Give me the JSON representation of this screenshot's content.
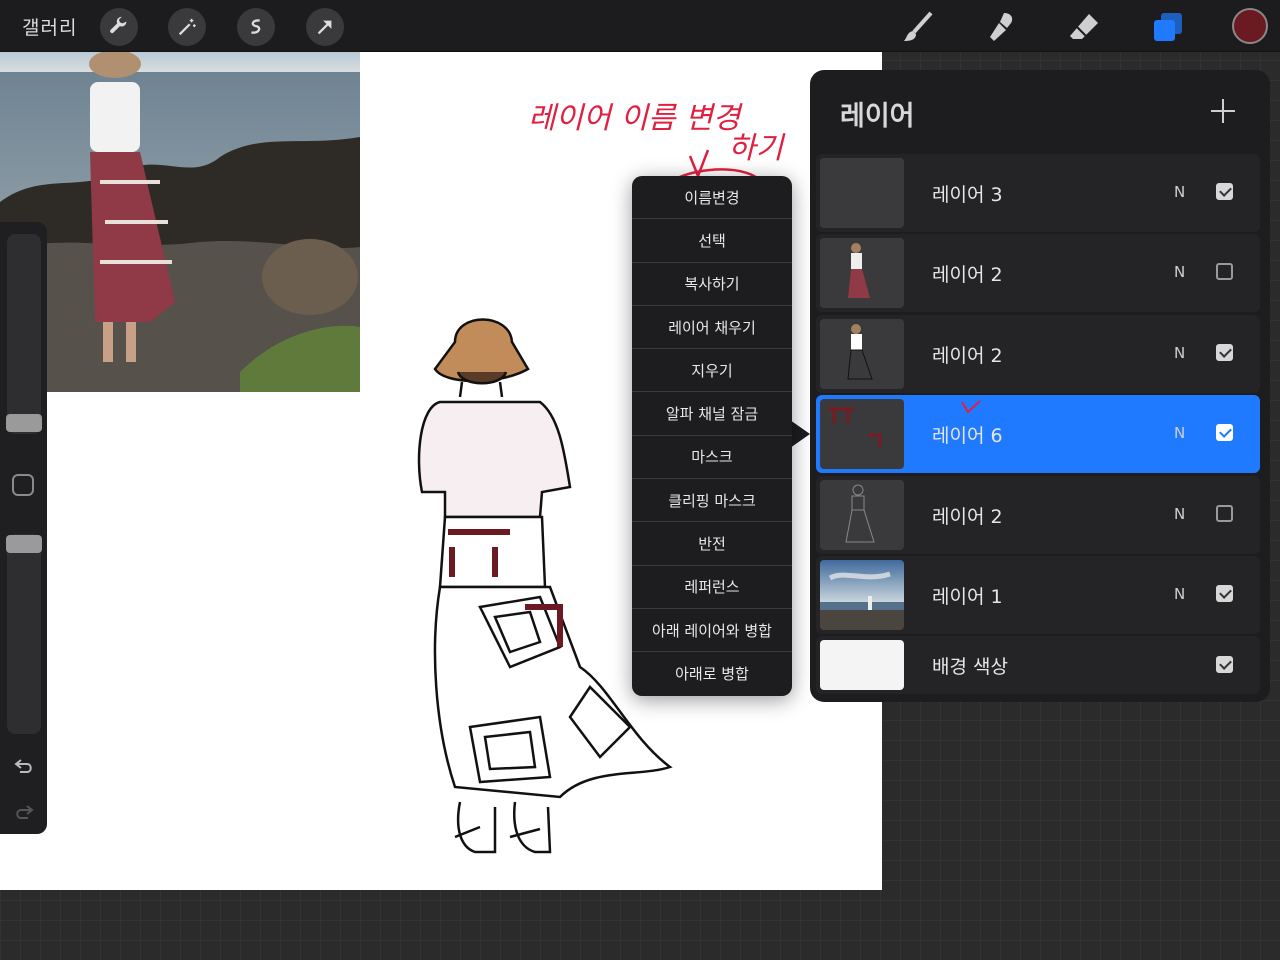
{
  "toolbar": {
    "gallery_label": "갤러리",
    "left_tools": [
      "wrench-icon",
      "magic-wand-icon",
      "selection-icon",
      "transform-arrow-icon"
    ],
    "right_tools": [
      "brush-icon",
      "smudge-icon",
      "eraser-icon",
      "layers-icon"
    ],
    "current_color": "#6b1a22",
    "accent": "#1f7aff"
  },
  "annotation": {
    "line1": "레이어 이름 변경",
    "line2": "하기",
    "color": "#e02040"
  },
  "context_menu": {
    "items": [
      "이름변경",
      "선택",
      "복사하기",
      "레이어 채우기",
      "지우기",
      "알파 채널 잠금",
      "마스크",
      "클리핑 마스크",
      "반전",
      "레퍼런스",
      "아래 레이어와 병합",
      "아래로 병합"
    ]
  },
  "layers_panel": {
    "title": "레이어",
    "layers": [
      {
        "name": "레이어 3",
        "blend": "N",
        "visible": true,
        "selected": false
      },
      {
        "name": "레이어 2",
        "blend": "N",
        "visible": false,
        "selected": false
      },
      {
        "name": "레이어 2",
        "blend": "N",
        "visible": true,
        "selected": false
      },
      {
        "name": "레이어 6",
        "blend": "N",
        "visible": true,
        "selected": true
      },
      {
        "name": "레이어 2",
        "blend": "N",
        "visible": false,
        "selected": false
      },
      {
        "name": "레이어 1",
        "blend": "N",
        "visible": true,
        "selected": false
      }
    ],
    "background": {
      "name": "배경 색상",
      "visible": true
    }
  }
}
